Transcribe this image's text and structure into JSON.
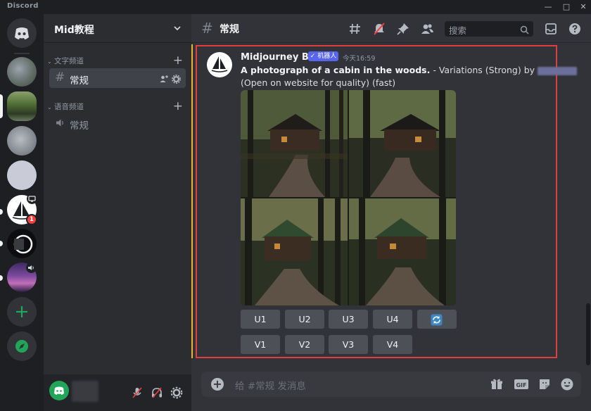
{
  "window": {
    "title": "Discord"
  },
  "server": {
    "name": "Mid教程"
  },
  "categories": {
    "text": "文字频道",
    "voice": "语音频道"
  },
  "channels": {
    "text_general": "常规",
    "voice_general": "常规"
  },
  "header": {
    "channel_name": "常规",
    "search_placeholder": "搜索"
  },
  "guild_badges": {
    "midjourney_mentions": "1"
  },
  "message": {
    "author": "Midjourney Bot",
    "bot_badge": "✓ 机器人",
    "timestamp": "今天16:59",
    "prompt": "A photograph of a cabin in the woods.",
    "suffix": "- Variations (Strong) by",
    "line2": "(Open on website for quality) (fast)"
  },
  "buttons": {
    "upscale": [
      "U1",
      "U2",
      "U3",
      "U4"
    ],
    "variation": [
      "V1",
      "V2",
      "V3",
      "V4"
    ]
  },
  "composer": {
    "placeholder": "给 #常规 发消息"
  },
  "colors": {
    "accent": "#5865f2",
    "highlight_border": "#e03e3e",
    "mention_bar": "#f0b232",
    "online": "#23a559"
  }
}
